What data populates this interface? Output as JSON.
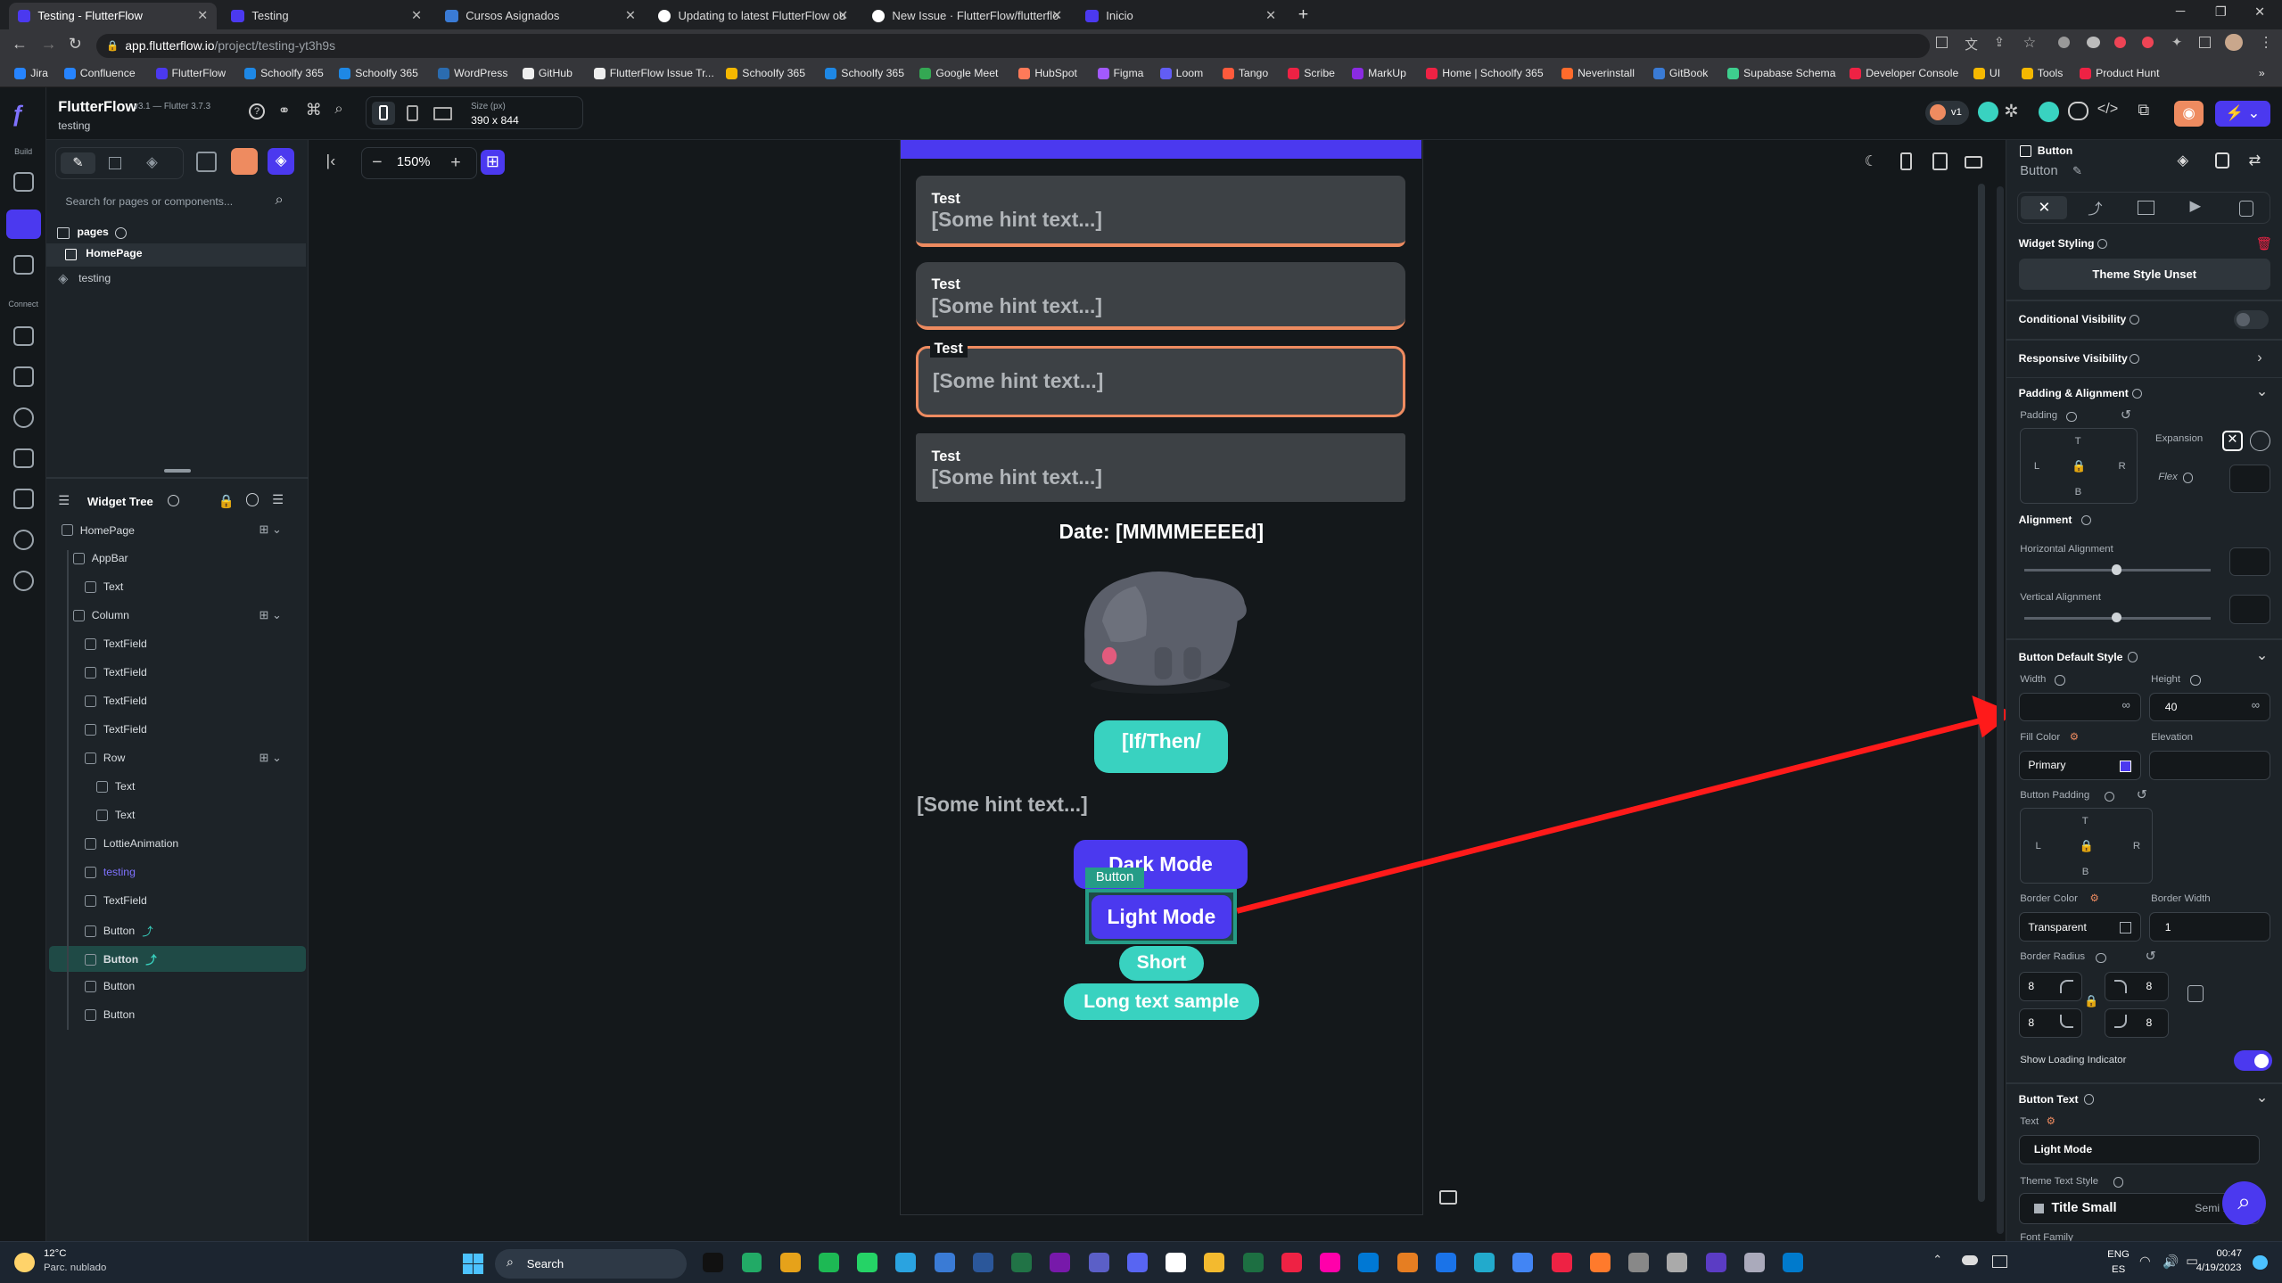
{
  "browser": {
    "tabs": [
      {
        "title": "Testing - FlutterFlow",
        "active": true,
        "color": "#4b39ef"
      },
      {
        "title": "Testing",
        "active": false,
        "color": "#4b39ef"
      },
      {
        "title": "Cursos Asignados",
        "active": false,
        "color": "#3a7bd5"
      },
      {
        "title": "Updating to latest FlutterFlow ou",
        "active": false,
        "color": "#ffffff"
      },
      {
        "title": "New Issue · FlutterFlow/flutterflo",
        "active": false,
        "color": "#ffffff"
      },
      {
        "title": "Inicio",
        "active": false,
        "color": "#4b39ef"
      }
    ],
    "new_tab": "+",
    "url_host": "app.flutterflow.io",
    "url_path": "/project/testing-yt3h9s",
    "bookmarks": [
      "Jira",
      "Confluence",
      "FlutterFlow",
      "Schoolfy 365",
      "Schoolfy 365",
      "WordPress",
      "GitHub",
      "FlutterFlow Issue Tr...",
      "Schoolfy 365",
      "Schoolfy 365",
      "Google Meet",
      "HubSpot",
      "Figma",
      "Loom",
      "Tango",
      "Scribe",
      "MarkUp",
      "Home | Schoolfy 365",
      "Neverinstall",
      "GitBook",
      "Supabase Schema",
      "Developer Console",
      "UI",
      "Tools",
      "Product Hunt"
    ]
  },
  "app": {
    "name": "FlutterFlow",
    "version": "v3.1 — Flutter 3.7.3",
    "project": "testing",
    "size_label": "Size (px)",
    "size_value": "390 x 844",
    "version_badge": "v1",
    "rail": {
      "build": "Build",
      "connect": "Connect"
    }
  },
  "left_panel": {
    "search_placeholder": "Search for pages or components...",
    "pages_label": "pages",
    "pages": [
      "HomePage",
      "testing"
    ],
    "widget_tree_label": "Widget Tree",
    "tree": [
      {
        "label": "HomePage",
        "depth": 0
      },
      {
        "label": "AppBar",
        "depth": 1
      },
      {
        "label": "Text",
        "depth": 2
      },
      {
        "label": "Column",
        "depth": 1
      },
      {
        "label": "TextField",
        "depth": 2
      },
      {
        "label": "TextField",
        "depth": 2
      },
      {
        "label": "TextField",
        "depth": 2
      },
      {
        "label": "TextField",
        "depth": 2
      },
      {
        "label": "Row",
        "depth": 2
      },
      {
        "label": "Text",
        "depth": 3
      },
      {
        "label": "Text",
        "depth": 3
      },
      {
        "label": "LottieAnimation",
        "depth": 2
      },
      {
        "label": "testing",
        "depth": 2
      },
      {
        "label": "TextField",
        "depth": 2
      },
      {
        "label": "Button",
        "depth": 2
      },
      {
        "label": "Button",
        "depth": 2,
        "selected": true
      },
      {
        "label": "Button",
        "depth": 2
      },
      {
        "label": "Button",
        "depth": 2
      }
    ]
  },
  "canvas": {
    "zoom": "150%",
    "textfields": [
      {
        "label": "Test",
        "hint": "[Some hint text...]"
      },
      {
        "label": "Test",
        "hint": "[Some hint text...]"
      },
      {
        "label": "Test",
        "hint": "[Some hint text...]"
      },
      {
        "label": "Test",
        "hint": "[Some hint text...]"
      }
    ],
    "date_text": "Date: [MMMMEEEEd]",
    "ifthen_button": "[If/Then/",
    "plain_hint": "[Some hint text...]",
    "dark_mode": "Dark Mode",
    "selected_tag": "Button",
    "light_mode": "Light Mode",
    "short": "Short",
    "long_text": "Long text sample",
    "colors": {
      "primary": "#4b39ef",
      "teal": "#39d2c0",
      "orange": "#ee8b60",
      "arrow": "#ff1a1a"
    }
  },
  "right_panel": {
    "widget_type": "Button",
    "widget_name": "Button",
    "widget_styling": "Widget Styling",
    "theme_style": "Theme Style Unset",
    "conditional_visibility": "Conditional Visibility",
    "responsive_visibility": "Responsive Visibility",
    "padding_alignment": "Padding & Alignment",
    "padding": "Padding",
    "expansion": "Expansion",
    "flex": "Flex",
    "alignment": "Alignment",
    "horizontal_alignment": "Horizontal Alignment",
    "vertical_alignment": "Vertical Alignment",
    "button_default_style": "Button Default Style",
    "width_label": "Width",
    "width_value": "",
    "height_label": "Height",
    "height_value": "40",
    "inf": "∞",
    "fill_color_label": "Fill Color",
    "fill_color_value": "Primary",
    "elevation_label": "Elevation",
    "button_padding": "Button Padding",
    "border_color_label": "Border Color",
    "border_color_value": "Transparent",
    "border_width_label": "Border Width",
    "border_width_value": "1",
    "border_radius_label": "Border Radius",
    "radius_values": [
      "8",
      "8",
      "8",
      "8"
    ],
    "show_loading": "Show Loading Indicator",
    "show_loading_on": true,
    "button_text": "Button Text",
    "text_label": "Text",
    "text_value": "Light Mode",
    "theme_text_style": "Theme Text Style",
    "text_style_value": "Title Small",
    "text_style_weight": "Semi Bold,",
    "font_family": "Font Family",
    "side_letters": {
      "t": "T",
      "l": "L",
      "r": "R",
      "b": "B"
    }
  },
  "taskbar": {
    "weather_temp": "12°C",
    "weather_desc": "Parc. nublado",
    "search": "Search",
    "lang1": "ENG",
    "lang2": "ES",
    "time": "00:47",
    "date": "4/19/2023"
  }
}
